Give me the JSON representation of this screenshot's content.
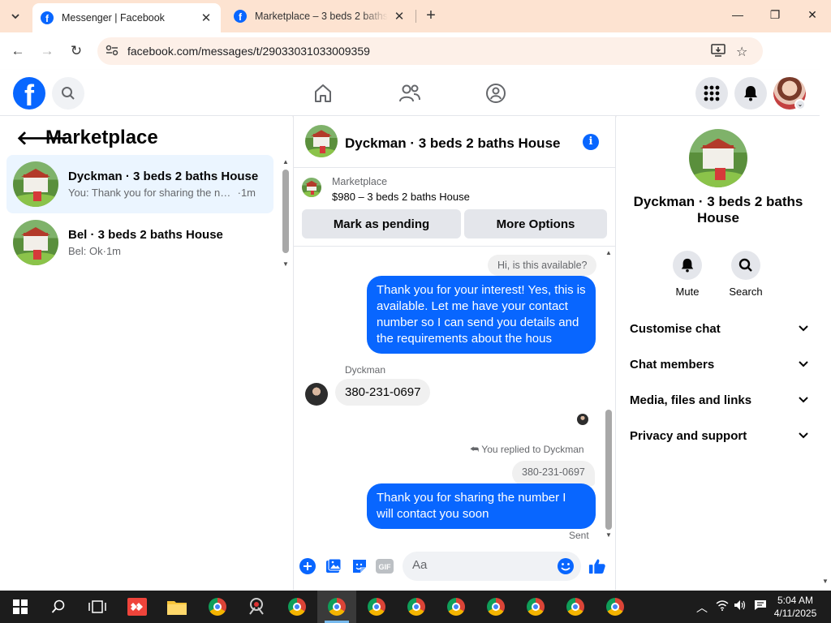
{
  "browser": {
    "tabs": [
      {
        "title": "Messenger | Facebook",
        "active": true
      },
      {
        "title": "Marketplace – 3 beds 2 baths House",
        "active": false
      }
    ],
    "url": "facebook.com/messages/t/29033031033009359"
  },
  "left_panel": {
    "title": "Marketplace",
    "conversations": [
      {
        "name": "Dyckman · 3 beds 2 baths House",
        "snippet": "You: Thank you for sharing the number I will contact you soon",
        "time": "·1m",
        "selected": true
      },
      {
        "name": "Bel · 3 beds 2 baths House",
        "snippet": "Bel: Ok",
        "time": "·1m",
        "selected": false
      }
    ]
  },
  "chat": {
    "title": "Dyckman · 3 beds 2 baths House",
    "listing": {
      "source": "Marketplace",
      "price_line": "$980 – 3 beds 2 baths House",
      "btn_pending": "Mark as pending",
      "btn_more": "More Options"
    },
    "messages": {
      "prev_in": "Hi, is this available?",
      "out1": "Thank you for your interest! Yes, this is available. Let me have your contact number so I can send you details and the requirements about the hous",
      "sender": "Dyckman",
      "in1": "380-231-0697",
      "replied_to": "You replied to Dyckman",
      "reply_preview": "380-231-0697",
      "out2": "Thank you for sharing the number I will contact you soon",
      "status": "Sent"
    },
    "composer_placeholder": "Aa"
  },
  "right_panel": {
    "name": "Dyckman · 3 beds 2 baths House",
    "actions": [
      {
        "label": "Mute",
        "icon": "bell-icon"
      },
      {
        "label": "Search",
        "icon": "search-icon"
      }
    ],
    "sections": [
      "Customise chat",
      "Chat members",
      "Media, files and links",
      "Privacy and support"
    ]
  },
  "taskbar": {
    "time": "5:04 AM",
    "date": "4/11/2025"
  },
  "colors": {
    "accent": "#0866ff",
    "tabbar": "#fde3d1",
    "selected_conv": "#ebf5ff"
  }
}
